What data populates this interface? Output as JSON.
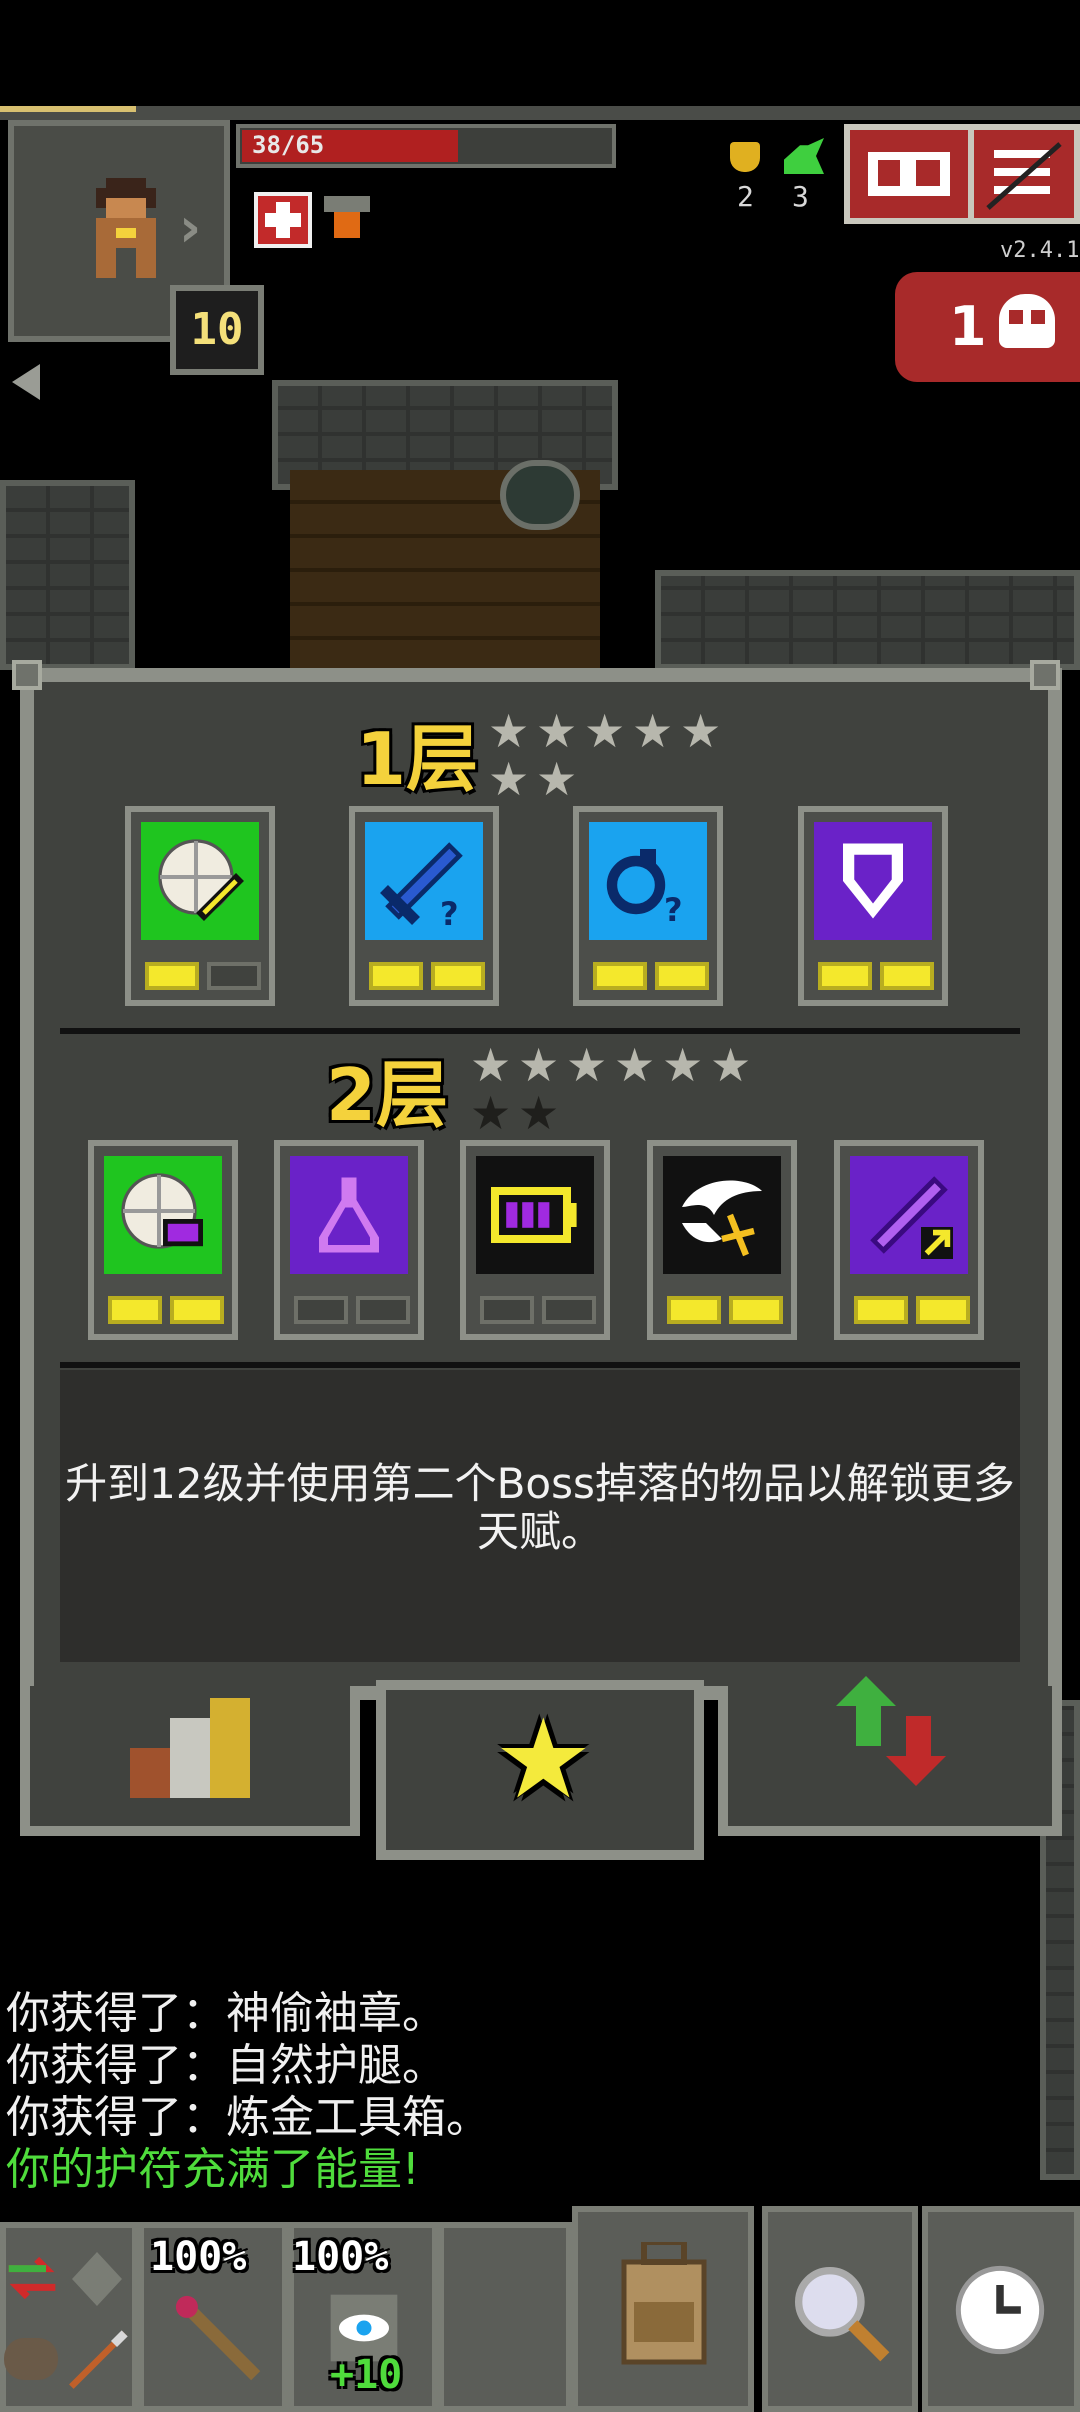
{
  "hud": {
    "hp_text": "38/65",
    "hp_fraction": 0.58,
    "level": "10",
    "challenges_count": "2",
    "iron_keys_count": "3",
    "version": "v2.4.1",
    "danger_count": "1"
  },
  "talents": {
    "tier1": {
      "title": "1层",
      "stars_total": 7,
      "talents": [
        {
          "name": "talent-shield-sword",
          "color": "#1fc51f",
          "points": 1
        },
        {
          "name": "talent-blue-sword",
          "color": "#1aa3ef",
          "points": 2
        },
        {
          "name": "talent-blue-key",
          "color": "#1aa3ef",
          "points": 2
        },
        {
          "name": "talent-purple-shield",
          "color": "#6a22c8",
          "points": 2
        }
      ]
    },
    "tier2": {
      "title": "2层",
      "stars_total": 8,
      "stars_dim": 2,
      "talents": [
        {
          "name": "talent-shield-purple",
          "color": "#1fc51f",
          "points": 2
        },
        {
          "name": "talent-potion",
          "color": "#6a22c8",
          "points": 0
        },
        {
          "name": "talent-battery",
          "color": "#111111",
          "points": 0
        },
        {
          "name": "talent-wings",
          "color": "#111111",
          "points": 2
        },
        {
          "name": "talent-purple-sword",
          "color": "#6a22c8",
          "points": 2
        }
      ]
    },
    "description": "升到12级并使用第二个Boss掉落的物品以解锁更多天赋。"
  },
  "tabs": [
    "stats",
    "talents",
    "level-up"
  ],
  "log": [
    {
      "text": "你获得了：神偷袖章。",
      "color": "#f0f0f0"
    },
    {
      "text": "你获得了：自然护腿。",
      "color": "#f0f0f0"
    },
    {
      "text": "你获得了：炼金工具箱。",
      "color": "#f0f0f0"
    },
    {
      "text": "你的护符充满了能量!",
      "color": "#4fdc3c"
    }
  ],
  "quickslots": {
    "slot1_percent": "100%",
    "slot2_percent": "100%",
    "slot2_bonus": "+10"
  }
}
